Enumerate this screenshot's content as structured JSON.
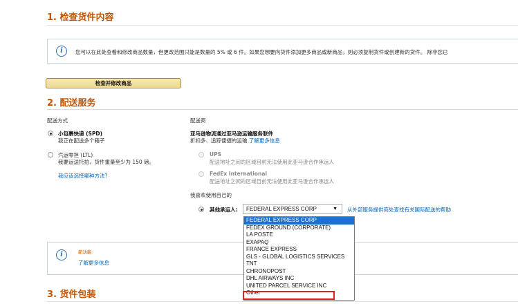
{
  "section1": {
    "title": "1. 检查货件内容"
  },
  "info_bar": {
    "text": "您可以在此处查看和修改商品数量，但更改范围只能是数量的 5% 或 6 件。如果您想要向货件添加更多商品或新商品，则必须复制货件或创建新的货件。 除非您已"
  },
  "check_button": {
    "label": "检查并修改商品"
  },
  "section2": {
    "title": "2. 配送服务"
  },
  "shipping_method": {
    "heading": "配送方式",
    "options": [
      {
        "label": "小包裹快递 (SPD)",
        "sub": "我正在配送多个箱子",
        "checked": true
      },
      {
        "label": "汽运零担 (LTL)",
        "sub": "我要运送托拍，货件重量至少为 150 磅。",
        "checked": false
      }
    ],
    "help_link": "我应该选择哪种方法？"
  },
  "carrier": {
    "heading": "配送商",
    "partnered_title": "亚马逊物流通过亚马逊运输服务联件",
    "partnered_sub": "折扣多、追踪便捷的运输",
    "partnered_link": "了解更多信息",
    "options": [
      {
        "label": "UPS",
        "sub": "配送地址之间的区域目前无法使用此亚马逊合作承运人"
      },
      {
        "label": "FedEx International",
        "sub": "配送地址之间的区域目前无法使用此亚马逊合作承运人"
      }
    ],
    "own_heading": "我喜欢使用自己的",
    "other_label": "其他承运人:",
    "selected_value": "FEDERAL EXPRESS CORP",
    "help_link": "从外部服务提供商处查找有关国际配送的帮助"
  },
  "dropdown_options": [
    "FEDERAL EXPRESS CORP",
    "FEDEX GROUND (CORPORATE)",
    "LA POSTE",
    "EXAPAQ",
    "FRANCE EXPRESS",
    "GLS - GLOBAL LOGISTICS SERVICES",
    "TNT",
    "CHRONOPOST",
    "DHL AIRWAYS INC",
    "UNITED PARCEL SERVICE INC",
    "Other"
  ],
  "new_feature": {
    "badge": "新功能",
    "link": "了解更多信息"
  },
  "section3": {
    "title": "3. 货件包装"
  },
  "colors": {
    "accent": "#c45500",
    "link": "#0066c0",
    "selected": "#1e6fd0",
    "highlight": "#e02020"
  }
}
